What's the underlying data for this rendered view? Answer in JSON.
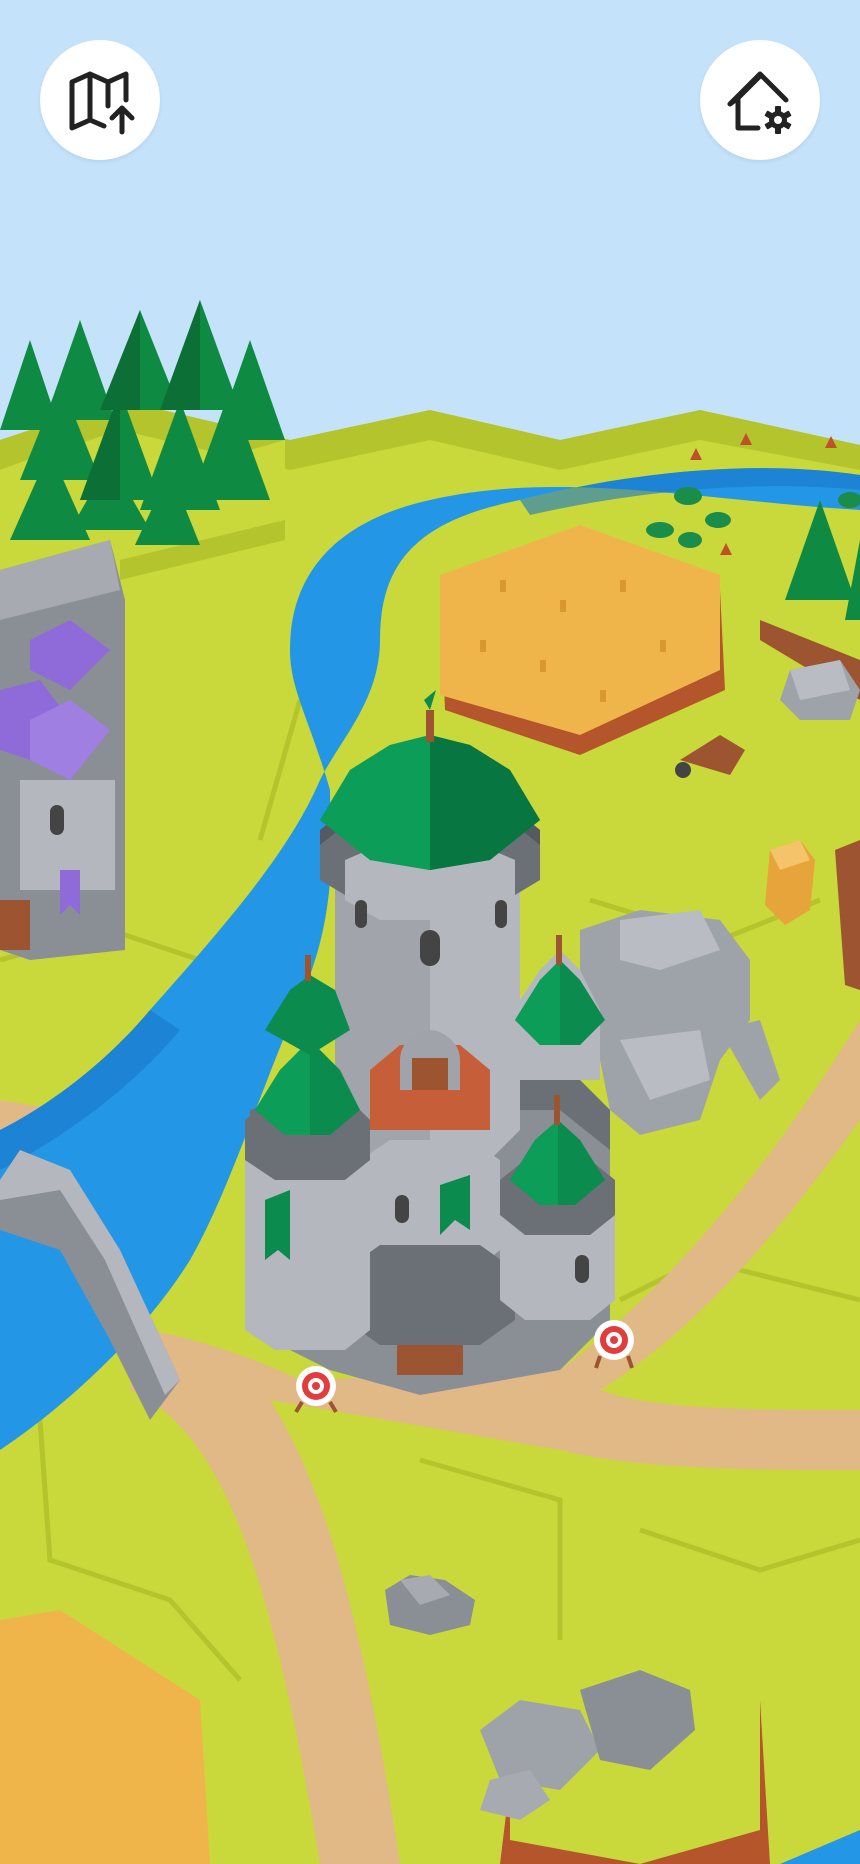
{
  "colors": {
    "sky": "#c4e3fb",
    "grass": "#c9d83a",
    "grass_edge": "#b4c42c",
    "river": "#2496e6",
    "river_dark": "#1976c8",
    "path": "#e1b987",
    "field": "#f0b54a",
    "stone": "#9ea3aa",
    "stone_dark": "#6b7077",
    "roof_green": "#0b8b4d",
    "roof_purple": "#8f6ad9",
    "tree": "#0f8a42",
    "button_bg": "#ffffff",
    "icon": "#222222"
  },
  "hud": {
    "left_button_icon": "map-upload-icon",
    "right_button_icon": "house-settings-icon"
  },
  "scene": {
    "main_building": "castle-tower",
    "features": [
      "pine-forest",
      "river",
      "wheat-field",
      "stone-bridge",
      "archery-target",
      "rock",
      "hay-bale",
      "wheelbarrow",
      "purple-roof-castle",
      "lily-pads",
      "boulders"
    ]
  }
}
